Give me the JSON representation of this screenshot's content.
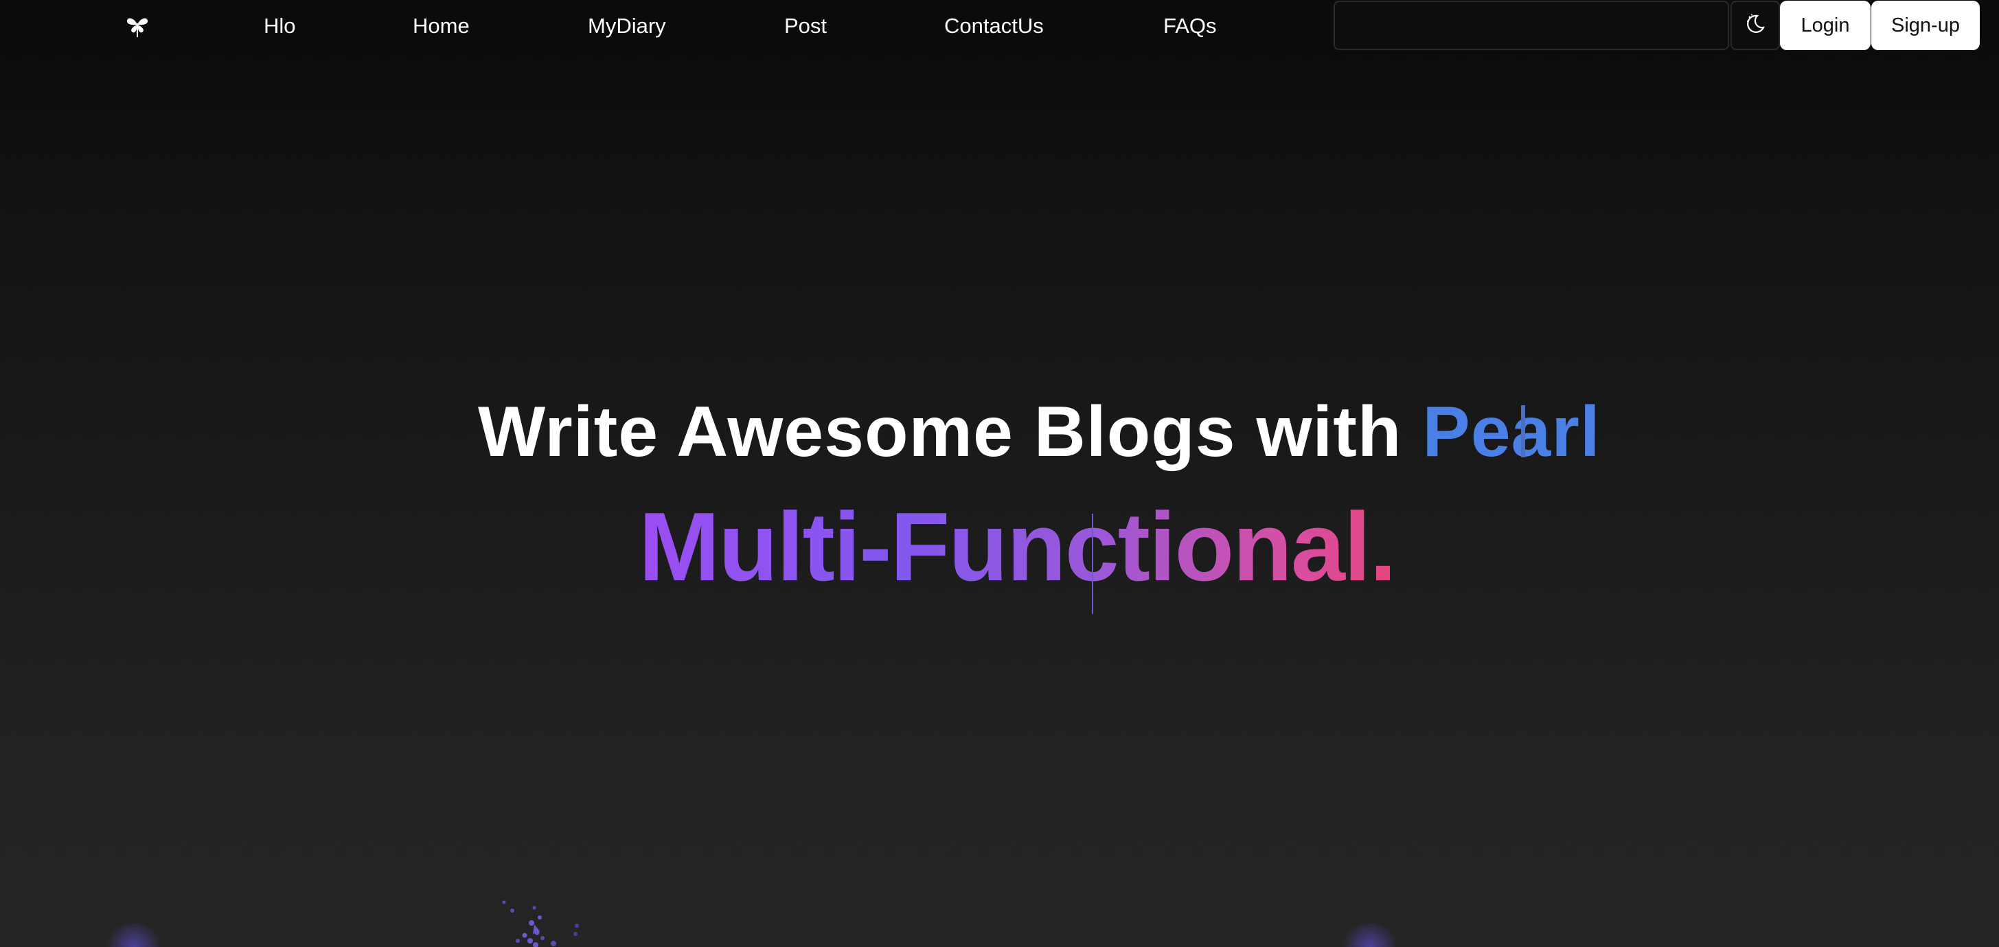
{
  "nav": {
    "logo_icon": "leaf-logo-icon",
    "links": [
      "Hlo",
      "Home",
      "MyDiary",
      "Post",
      "ContactUs",
      "FAQs"
    ],
    "search": {
      "value": "",
      "placeholder": ""
    },
    "theme_icon": "moon-icon",
    "login_label": "Login",
    "signup_label": "Sign-up"
  },
  "hero": {
    "line1_prefix": "Write Awesome Blogs with",
    "line1_typed": "Pearl",
    "line2": "Multi-Functional."
  },
  "colors": {
    "typed_accent": "#4a7fe6",
    "gradient_start": "#9b4ef2",
    "gradient_end": "#e5457e",
    "background": "#1a1a1a"
  }
}
